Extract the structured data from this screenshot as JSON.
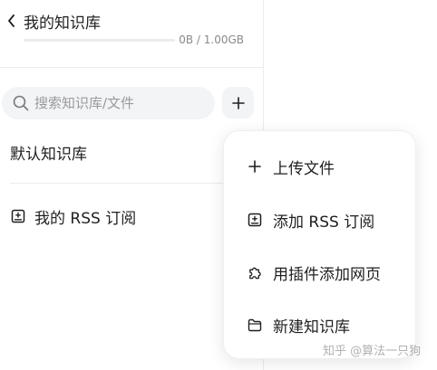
{
  "header": {
    "title": "我的知识库",
    "storage_text": "0B / 1.00GB",
    "storage_used_fraction": 0
  },
  "search": {
    "placeholder": "搜索知识库/文件"
  },
  "sidebar": {
    "items": [
      {
        "label": "默认知识库"
      },
      {
        "label": "我的 RSS 订阅",
        "icon": "rss-subscription-icon"
      }
    ]
  },
  "add_menu": {
    "items": [
      {
        "label": "上传文件",
        "icon": "plus-icon"
      },
      {
        "label": "添加 RSS 订阅",
        "icon": "rss-add-icon"
      },
      {
        "label": "用插件添加网页",
        "icon": "puzzle-icon"
      },
      {
        "label": "新建知识库",
        "icon": "folder-icon"
      }
    ]
  },
  "watermark": "知乎 @算法一只狗",
  "colors": {
    "accent": "#1f6feb",
    "surface_gray": "#f3f4f6",
    "text_primary": "#1f1f1f",
    "text_muted": "#8a8a8a"
  }
}
